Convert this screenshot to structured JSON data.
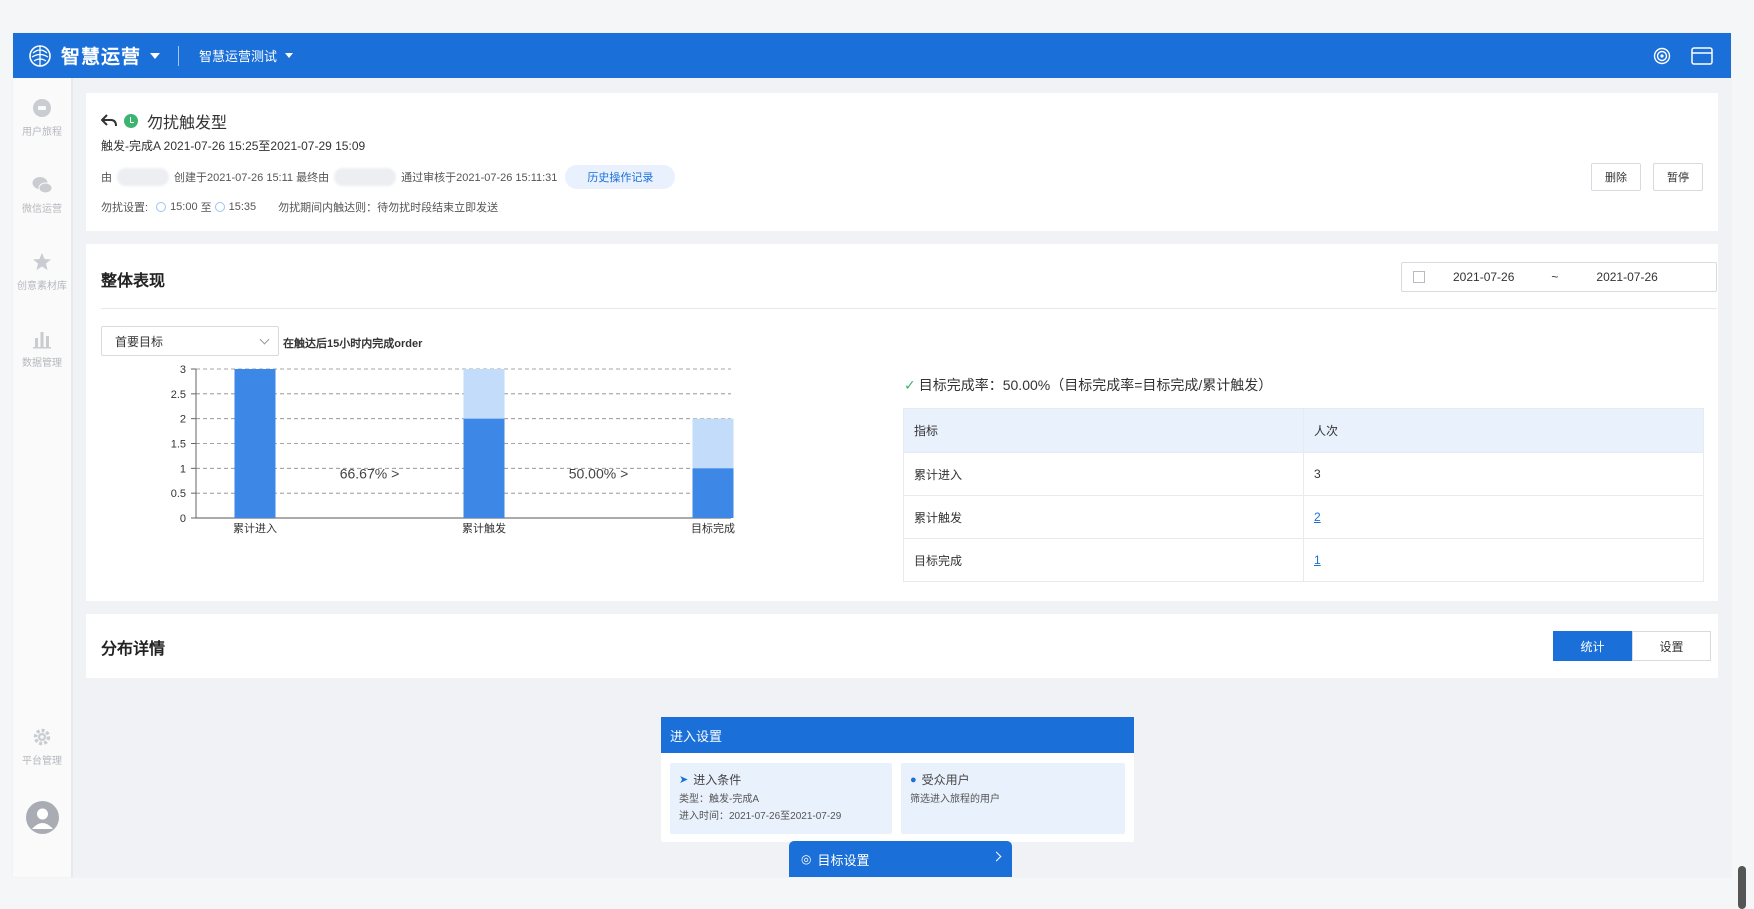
{
  "topbar": {
    "brand_name": "智慧运营",
    "project_name": "智慧运营测试"
  },
  "sidebar": {
    "items": [
      {
        "label": "用户旅程",
        "icon": "journey-icon"
      },
      {
        "label": "微信运营",
        "icon": "wechat-icon"
      },
      {
        "label": "创意素材库",
        "icon": "creative-icon"
      },
      {
        "label": "数据管理",
        "icon": "bar-chart-icon"
      },
      {
        "label": "平台管理",
        "icon": "gear-icon"
      }
    ]
  },
  "header": {
    "title": "勿扰触发型",
    "subtitle": "触发-完成A 2021-07-26 15:25至2021-07-29 15:09",
    "by_prefix": "由",
    "created": "创建于2021-07-26 15:11 最终由",
    "approved": "通过审核于2021-07-26 15:11:31",
    "history_button": "历史操作记录",
    "dnd_label": "勿扰设置:",
    "dnd_start": "15:00",
    "dnd_to": "至",
    "dnd_end": "15:35",
    "dnd_rule": "勿扰期间内触达则：待勿扰时段结束立即发送",
    "delete_button": "删除",
    "pause_button": "暂停"
  },
  "overall": {
    "title": "整体表现",
    "date_start": "2021-07-26",
    "date_sep": "~",
    "date_end": "2021-07-26",
    "goal_select": "首要目标",
    "goal_note": "在触达后15小时内完成order",
    "rate_text": "目标完成率：50.00%（目标完成率=目标完成/累计触发）",
    "table": {
      "headers": [
        "指标",
        "人次"
      ],
      "rows": [
        [
          "累计进入",
          "3"
        ],
        [
          "累计触发",
          "2"
        ],
        [
          "目标完成",
          "1"
        ]
      ]
    }
  },
  "chart_data": {
    "type": "bar",
    "categories": [
      "累计进入",
      "累计触发",
      "目标完成"
    ],
    "series": [
      {
        "values": [
          3,
          2,
          1
        ]
      },
      {
        "values": [
          3,
          3,
          2
        ]
      }
    ],
    "conversion_labels": [
      "66.67% >",
      "50.00% >"
    ],
    "yticks": [
      "0",
      "0.5",
      "1",
      "1.5",
      "2",
      "2.5",
      "3"
    ],
    "ylim": [
      0,
      3
    ],
    "grid": true,
    "colors": {
      "primary": "#3d87e6",
      "secondary": "#c2dcfa"
    }
  },
  "distribution": {
    "title": "分布详情",
    "tab_stats": "统计",
    "tab_settings": "设置"
  },
  "flow": {
    "entry_header": "进入设置",
    "condition_title": "进入条件",
    "condition_type": "类型：触发-完成A",
    "condition_time": "进入时间：2021-07-26至2021-07-29",
    "audience_title": "受众用户",
    "audience_desc": "筛选进入旅程的用户",
    "goal_header": "目标设置"
  },
  "colors": {
    "brand": "#1a6fd8",
    "success": "#3cb371"
  }
}
